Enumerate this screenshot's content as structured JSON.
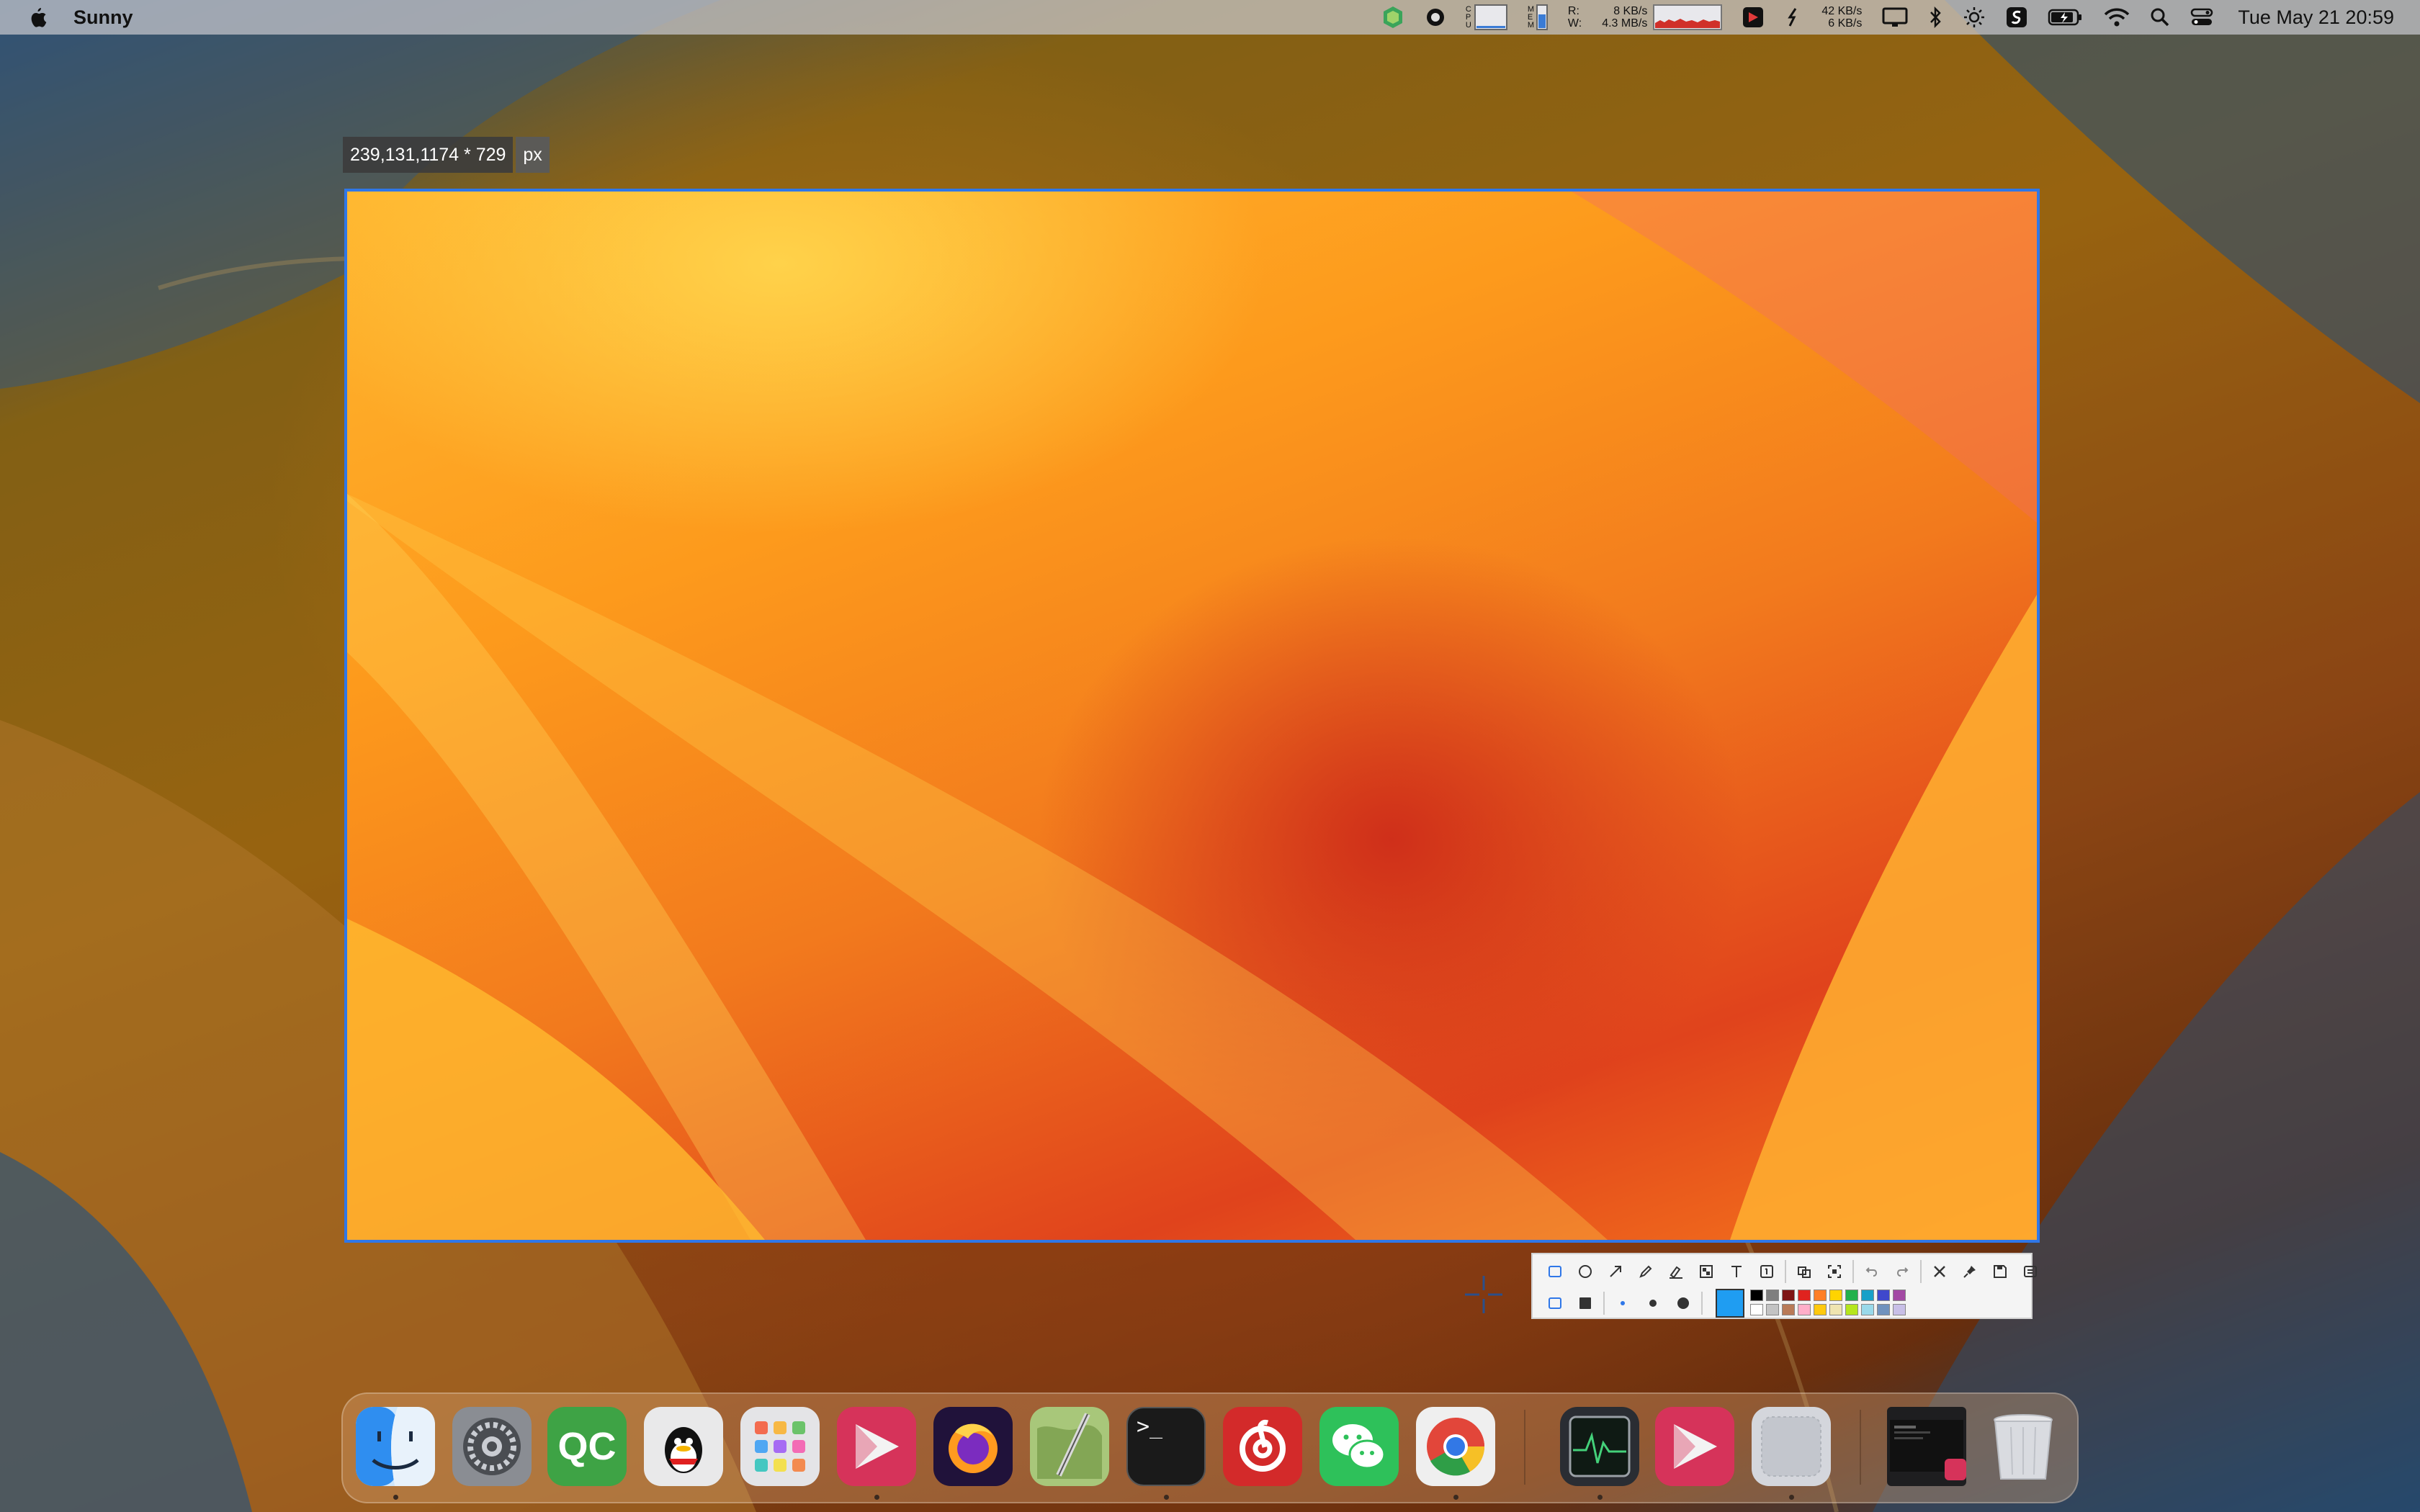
{
  "menubar": {
    "app_name": "Sunny",
    "icons": [
      "apple-icon",
      "sunny-app-icon",
      "record-icon",
      "cpu-monitor-icon",
      "mem-monitor-icon",
      "disk-rw-monitor-icon",
      "parallels-icon",
      "sync-icon",
      "network-speed-icon",
      "display-icon",
      "bluetooth-icon",
      "brightness-icon",
      "screenshot-app-icon",
      "battery-icon",
      "wifi-icon",
      "spotlight-icon",
      "control-center-icon"
    ],
    "cpu_label": "C P U",
    "mem_label": "M E M",
    "disk_r_label": "R:",
    "disk_w_label": "W:",
    "disk_read": "8 KB/s",
    "disk_write": "4.3 MB/s",
    "net_up": "42 KB/s",
    "net_down": "6 KB/s",
    "clock": "Tue May 21  20:59"
  },
  "selection": {
    "size_text": "239,131,1174 * 729",
    "unit": "px",
    "border_color": "#2f77e8"
  },
  "toolbar": {
    "row1_tools": [
      "rectangle-icon",
      "ellipse-icon",
      "arrow-icon",
      "pencil-icon",
      "highlighter-icon",
      "mosaic-icon",
      "text-icon",
      "number-marker-icon",
      "ocr-icon",
      "scan-icon",
      "undo-icon",
      "redo-icon",
      "close-icon",
      "pin-icon",
      "save-icon",
      "copy-icon"
    ],
    "row2_tools": [
      "outline-rect-icon",
      "filled-rect-icon",
      "small-dot-icon",
      "medium-dot-icon",
      "large-dot-icon"
    ],
    "current_color": "#1f9df2",
    "palette_top": [
      "#000000",
      "#7f7f7f",
      "#7f1414",
      "#e0231f",
      "#ff7f27",
      "#ffd400",
      "#22b14c",
      "#18a0c8",
      "#3f48cc",
      "#a349a4"
    ],
    "palette_bottom": [
      "#ffffff",
      "#c3c3c3",
      "#b97a57",
      "#ffaec9",
      "#ffc90e",
      "#efe4b0",
      "#b5e61d",
      "#99d9ea",
      "#7092be",
      "#c8bfe7"
    ]
  },
  "dock": {
    "apps": [
      "finder-icon",
      "system-settings-icon",
      "qc-app-icon",
      "qq-icon",
      "launchpad-icon",
      "parallels-desktop-icon",
      "firefox-icon",
      "script-editor-icon",
      "terminal-icon",
      "netease-music-icon",
      "wechat-icon",
      "chrome-icon",
      "activity-monitor-icon",
      "parallels-desktop-2-icon",
      "blank-app-icon",
      "window-preview-icon",
      "trash-icon"
    ],
    "qc_label": "QC",
    "terminal_label": ">_"
  }
}
